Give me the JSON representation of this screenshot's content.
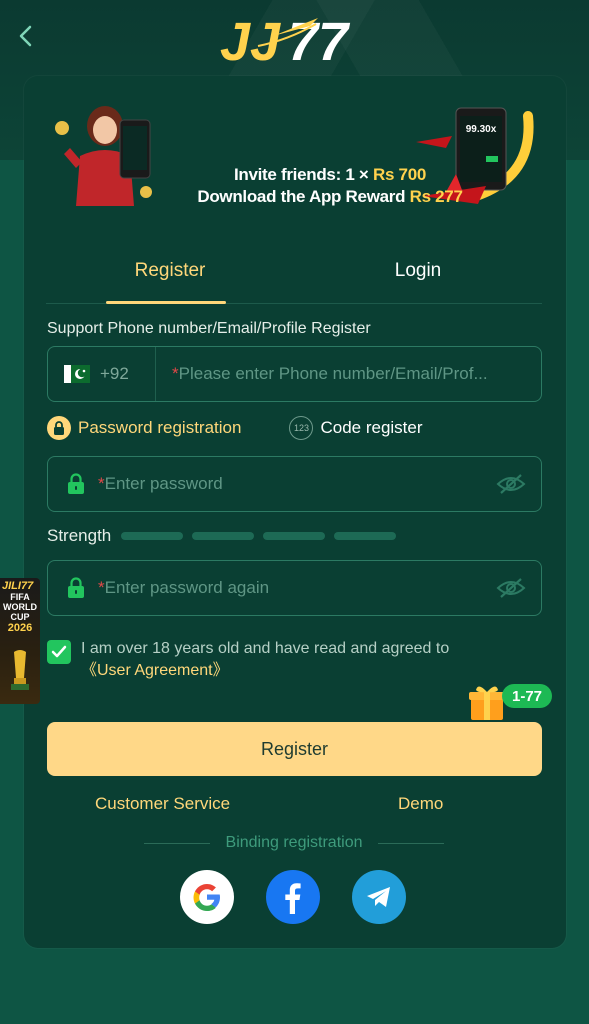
{
  "header": {
    "back_icon": "chevron-left-icon",
    "logo_text": "JILI77"
  },
  "banner": {
    "invite_prefix": "Invite friends: 1 × ",
    "invite_amount": "Rs 700",
    "download_prefix": "Download the App Reward ",
    "download_amount": "Rs 277",
    "phone_multiplier": "99.30x"
  },
  "tabs": [
    {
      "label": "Register",
      "active": true
    },
    {
      "label": "Login",
      "active": false
    }
  ],
  "phone": {
    "label": "Support Phone number/Email/Profile Register",
    "country_code": "+92",
    "placeholder_required": "*",
    "placeholder": "Please enter Phone number/Email/Prof..."
  },
  "modes": {
    "password_label": "Password registration",
    "code_label": "Code register",
    "code_icon_text": "123"
  },
  "password": {
    "required": "*",
    "placeholder": "Enter password",
    "confirm_placeholder": "Enter password again"
  },
  "strength": {
    "label": "Strength",
    "level": 0
  },
  "agreement": {
    "checked": true,
    "text": "I am over 18 years old and have read and agreed to",
    "link": "《User Agreement》"
  },
  "gift": {
    "badge": "1-77"
  },
  "register_button": "Register",
  "links": {
    "customer_service": "Customer Service",
    "demo": "Demo"
  },
  "binding": {
    "label": "Binding registration"
  },
  "side_promo": {
    "brand": "JILI77",
    "event": "FIFA WORLD CUP",
    "year": "2026"
  },
  "colors": {
    "background": "#0e5544",
    "card": "#0a3f33",
    "accent": "#ffd77a",
    "button": "#ffd888",
    "input_border": "#2c7a63",
    "checkbox": "#22c55e"
  }
}
